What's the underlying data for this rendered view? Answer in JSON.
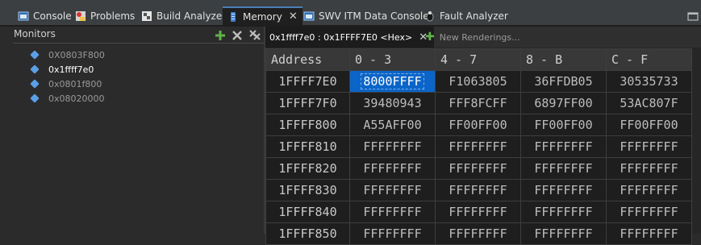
{
  "tabs": [
    {
      "label": "Console"
    },
    {
      "label": "Problems"
    },
    {
      "label": "Build Analyzer"
    },
    {
      "label": "Memory"
    },
    {
      "label": "SWV ITM Data Console"
    },
    {
      "label": "Fault Analyzer"
    }
  ],
  "monitors": {
    "title": "Monitors",
    "items": [
      "0X0803F800",
      "0x1ffff7e0",
      "0x0801f800",
      "0x08020000"
    ],
    "selected_index": 1
  },
  "rendering": {
    "tab_label": "0x1ffff7e0 : 0x1FFFF7E0 <Hex>",
    "new_label": "New Renderings..."
  },
  "memory": {
    "headers": [
      "Address",
      "0 - 3",
      "4 - 7",
      "8 - B",
      "C - F"
    ],
    "rows": [
      {
        "addr": "1FFFF7E0",
        "cells": [
          "8000FFFF",
          "F1063805",
          "36FFDB05",
          "30535733"
        ]
      },
      {
        "addr": "1FFFF7F0",
        "cells": [
          "39480943",
          "FFF8FCFF",
          "6897FF00",
          "53AC807F"
        ]
      },
      {
        "addr": "1FFFF800",
        "cells": [
          "A55AFF00",
          "FF00FF00",
          "FF00FF00",
          "FF00FF00"
        ]
      },
      {
        "addr": "1FFFF810",
        "cells": [
          "FFFFFFFF",
          "FFFFFFFF",
          "FFFFFFFF",
          "FFFFFFFF"
        ]
      },
      {
        "addr": "1FFFF820",
        "cells": [
          "FFFFFFFF",
          "FFFFFFFF",
          "FFFFFFFF",
          "FFFFFFFF"
        ]
      },
      {
        "addr": "1FFFF830",
        "cells": [
          "FFFFFFFF",
          "FFFFFFFF",
          "FFFFFFFF",
          "FFFFFFFF"
        ]
      },
      {
        "addr": "1FFFF840",
        "cells": [
          "FFFFFFFF",
          "FFFFFFFF",
          "FFFFFFFF",
          "FFFFFFFF"
        ]
      },
      {
        "addr": "1FFFF850",
        "cells": [
          "FFFFFFFF",
          "FFFFFFFF",
          "FFFFFFFF",
          "FFFFFFFF"
        ]
      }
    ]
  },
  "colors": {
    "accent": "#4a7fb5",
    "selection": "#0b65c8",
    "monitor_bullet": "#5aa0e6",
    "add_green": "#62b24a"
  }
}
